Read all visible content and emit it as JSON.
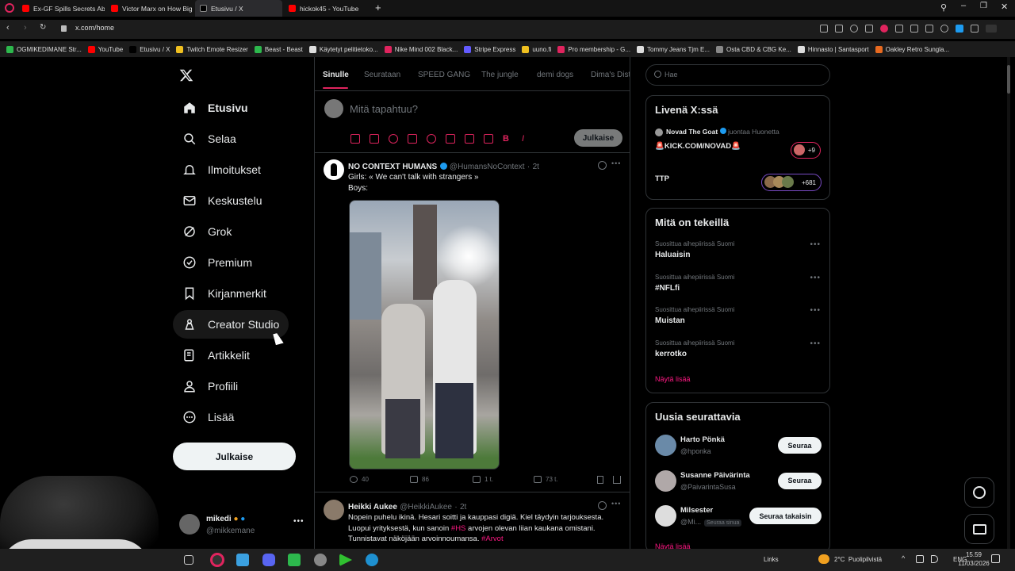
{
  "browser": {
    "tabs": [
      {
        "label": "Ex-GF Spills Secrets About",
        "color": "#ff0000"
      },
      {
        "label": "Victor Marx on How Big Ti",
        "color": "#ff0000"
      },
      {
        "label": "Etusivu / X",
        "color": "#000000"
      },
      {
        "label": "hickok45 - YouTube",
        "color": "#ff0000"
      }
    ],
    "url": "x.com/home",
    "bookmarks": [
      {
        "label": "OGMIKEDIMANE Str...",
        "color": "#2db84d"
      },
      {
        "label": "YouTube",
        "color": "#ff0000"
      },
      {
        "label": "Etusivu / X",
        "color": "#000000"
      },
      {
        "label": "Twitch Emote Resizer",
        "color": "#f0c020"
      },
      {
        "label": "Beast - Beast",
        "color": "#2db84d"
      },
      {
        "label": "Käytetyt pelitietoko...",
        "color": "#dddddd"
      },
      {
        "label": "Nike Mind 002 Black...",
        "color": "#e0245e"
      },
      {
        "label": "Stripe Express",
        "color": "#635bff"
      },
      {
        "label": "uuno.fi",
        "color": "#f0c020"
      },
      {
        "label": "Pro membership - G...",
        "color": "#e0245e"
      },
      {
        "label": "Tommy Jeans Tjm E...",
        "color": "#dddddd"
      },
      {
        "label": "Osta CBD & CBG Ke...",
        "color": "#888888"
      },
      {
        "label": "Hinnasto | Santasport",
        "color": "#dddddd"
      },
      {
        "label": "Oakley Retro Sungla...",
        "color": "#e86a20"
      }
    ]
  },
  "nav": {
    "items": [
      {
        "label": "Etusivu",
        "icon": "home-icon"
      },
      {
        "label": "Selaa",
        "icon": "search-icon"
      },
      {
        "label": "Ilmoitukset",
        "icon": "bell-icon"
      },
      {
        "label": "Keskustelu",
        "icon": "mail-icon"
      },
      {
        "label": "Grok",
        "icon": "grok-icon"
      },
      {
        "label": "Premium",
        "icon": "verified-icon"
      },
      {
        "label": "Kirjanmerkit",
        "icon": "bookmark-icon"
      },
      {
        "label": "Creator Studio",
        "icon": "creator-icon"
      },
      {
        "label": "Artikkelit",
        "icon": "article-icon"
      },
      {
        "label": "Profiili",
        "icon": "profile-icon"
      },
      {
        "label": "Lisää",
        "icon": "more-icon"
      }
    ],
    "post_label": "Julkaise",
    "account": {
      "name": "mikedi",
      "handle": "@mikkemane"
    }
  },
  "feed": {
    "tabs": [
      "Sinulle",
      "Seurataan",
      "SPEED GANG",
      "The jungle",
      "demi dogs",
      "Dima's Dist"
    ],
    "composer_placeholder": "Mitä tapahtuu?",
    "post_label": "Julkaise",
    "posts": [
      {
        "name": "NO CONTEXT HUMANS",
        "handle": "@HumansNoContext",
        "time": "2t",
        "text_line1": "Girls: « We can't talk with strangers »",
        "text_line2": "Boys:",
        "stats": {
          "replies": "40",
          "reposts": "86",
          "likes": "1 t.",
          "views": "73 t."
        }
      },
      {
        "name": "Heikki Aukee",
        "handle": "@HeikkiAukee",
        "time": "2t",
        "line1": "Nopein puhelu ikinä. Hesari soitti ja kauppasi digiä. Kiel täydyin tarjouksesta.",
        "line2_pre": "Luopui yrityksestä, kun sanoin ",
        "line2_tag": "#HS",
        "line2_post": " arvojen olevan liian kaukana omistani.",
        "line3_pre": "Tunnistavat näköjään arvoinnoumansa. ",
        "line3_tag": "#Arvot"
      }
    ]
  },
  "sidebar": {
    "search_placeholder": "Hae",
    "live": {
      "title": "Livenä X:ssä",
      "host_name": "Novad The Goat",
      "host_action": "juontaa Huonetta",
      "room1": "🚨KICK.COM/NOVAD🚨",
      "room1_count": "+9",
      "room2": "TTP",
      "room2_count": "+681"
    },
    "trends": {
      "title": "Mitä on tekeillä",
      "items": [
        {
          "sub": "Suosittua aihepiirissä Suomi",
          "name": "Haluaisin"
        },
        {
          "sub": "Suosittua aihepiirissä Suomi",
          "name": "#NFLfi"
        },
        {
          "sub": "Suosittua aihepiirissä Suomi",
          "name": "Muistan"
        },
        {
          "sub": "Suosittua aihepiirissä Suomi",
          "name": "kerrotko"
        }
      ],
      "show_more": "Näytä lisää"
    },
    "follow": {
      "title": "Uusia seurattavia",
      "items": [
        {
          "name": "Harto Pönkä",
          "handle": "@hponka",
          "button": "Seuraa"
        },
        {
          "name": "Susanne Päivärinta",
          "handle": "@PaivarintaSusa",
          "button": "Seuraa"
        },
        {
          "name": "Milsester",
          "handle": "@Mi...",
          "badge": "Seuraa sinua",
          "button": "Seuraa takaisin"
        }
      ],
      "show_more": "Näytä lisää"
    }
  },
  "taskbar": {
    "links": "Links",
    "weather": "2°C  Puolipilvistä",
    "lang": "ENG",
    "time": "15.59",
    "date": "11/03/2026"
  },
  "colors": {
    "accent": "#e0245e",
    "pink": "#f91880",
    "verified": "#1d9bf0"
  }
}
